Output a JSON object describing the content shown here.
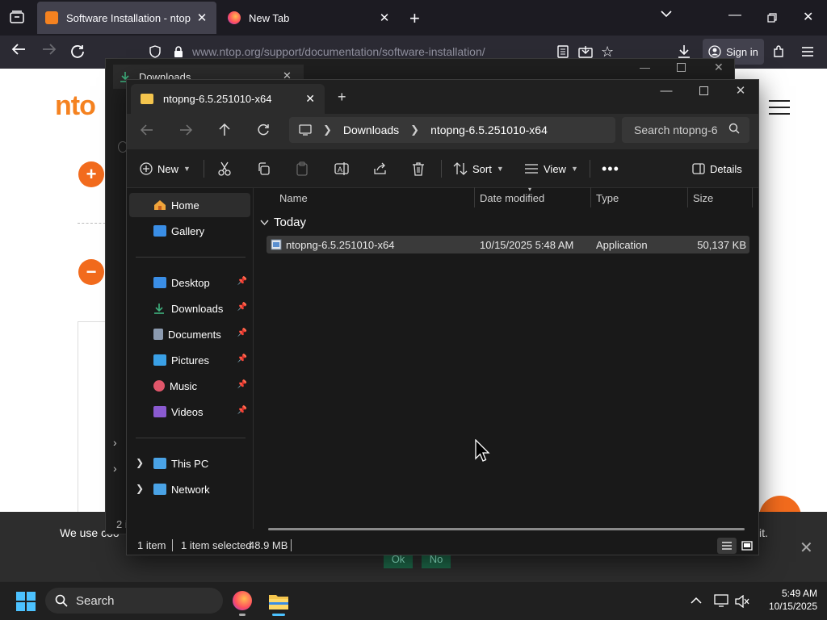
{
  "browser": {
    "tabs": [
      {
        "label": "Software Installation - ntop",
        "active": true
      },
      {
        "label": "New Tab",
        "active": false
      }
    ],
    "url": "www.ntop.org/support/documentation/software-installation/",
    "sign_in": "Sign in"
  },
  "website": {
    "logo_text": "nto",
    "cookie_text": "We use coo",
    "cookie_text_tail": "it.",
    "cookie_ok": "Ok",
    "cookie_no": "No",
    "background_status": "2 i"
  },
  "bg_explorer": {
    "tab_label": "Downloads"
  },
  "explorer": {
    "tab_label": "ntopng-6.5.251010-x64",
    "breadcrumb": [
      "Downloads",
      "ntopng-6.5.251010-x64"
    ],
    "search_placeholder": "Search ntopng-6",
    "commands": {
      "new": "New",
      "sort": "Sort",
      "view": "View",
      "details": "Details"
    },
    "nav": {
      "home": "Home",
      "gallery": "Gallery",
      "quick_access": [
        {
          "label": "Desktop",
          "icon": "desktop-icon",
          "color": "#3a8ee6"
        },
        {
          "label": "Downloads",
          "icon": "download-icon",
          "color": "#3fb27f"
        },
        {
          "label": "Documents",
          "icon": "document-icon",
          "color": "#8c9bb0"
        },
        {
          "label": "Pictures",
          "icon": "pictures-icon",
          "color": "#3aa0e6"
        },
        {
          "label": "Music",
          "icon": "music-icon",
          "color": "#e0566a"
        },
        {
          "label": "Videos",
          "icon": "videos-icon",
          "color": "#8a5ad0"
        }
      ],
      "this_pc": "This PC",
      "network": "Network"
    },
    "columns": {
      "name": "Name",
      "date": "Date modified",
      "type": "Type",
      "size": "Size"
    },
    "group": "Today",
    "files": [
      {
        "name": "ntopng-6.5.251010-x64",
        "date": "10/15/2025 5:48 AM",
        "type": "Application",
        "size": "50,137 KB"
      }
    ],
    "status": {
      "count": "1 item",
      "selected": "1 item selected",
      "size": "48.9 MB"
    }
  },
  "taskbar": {
    "search": "Search",
    "time": "5:49 AM",
    "date": "10/15/2025"
  }
}
